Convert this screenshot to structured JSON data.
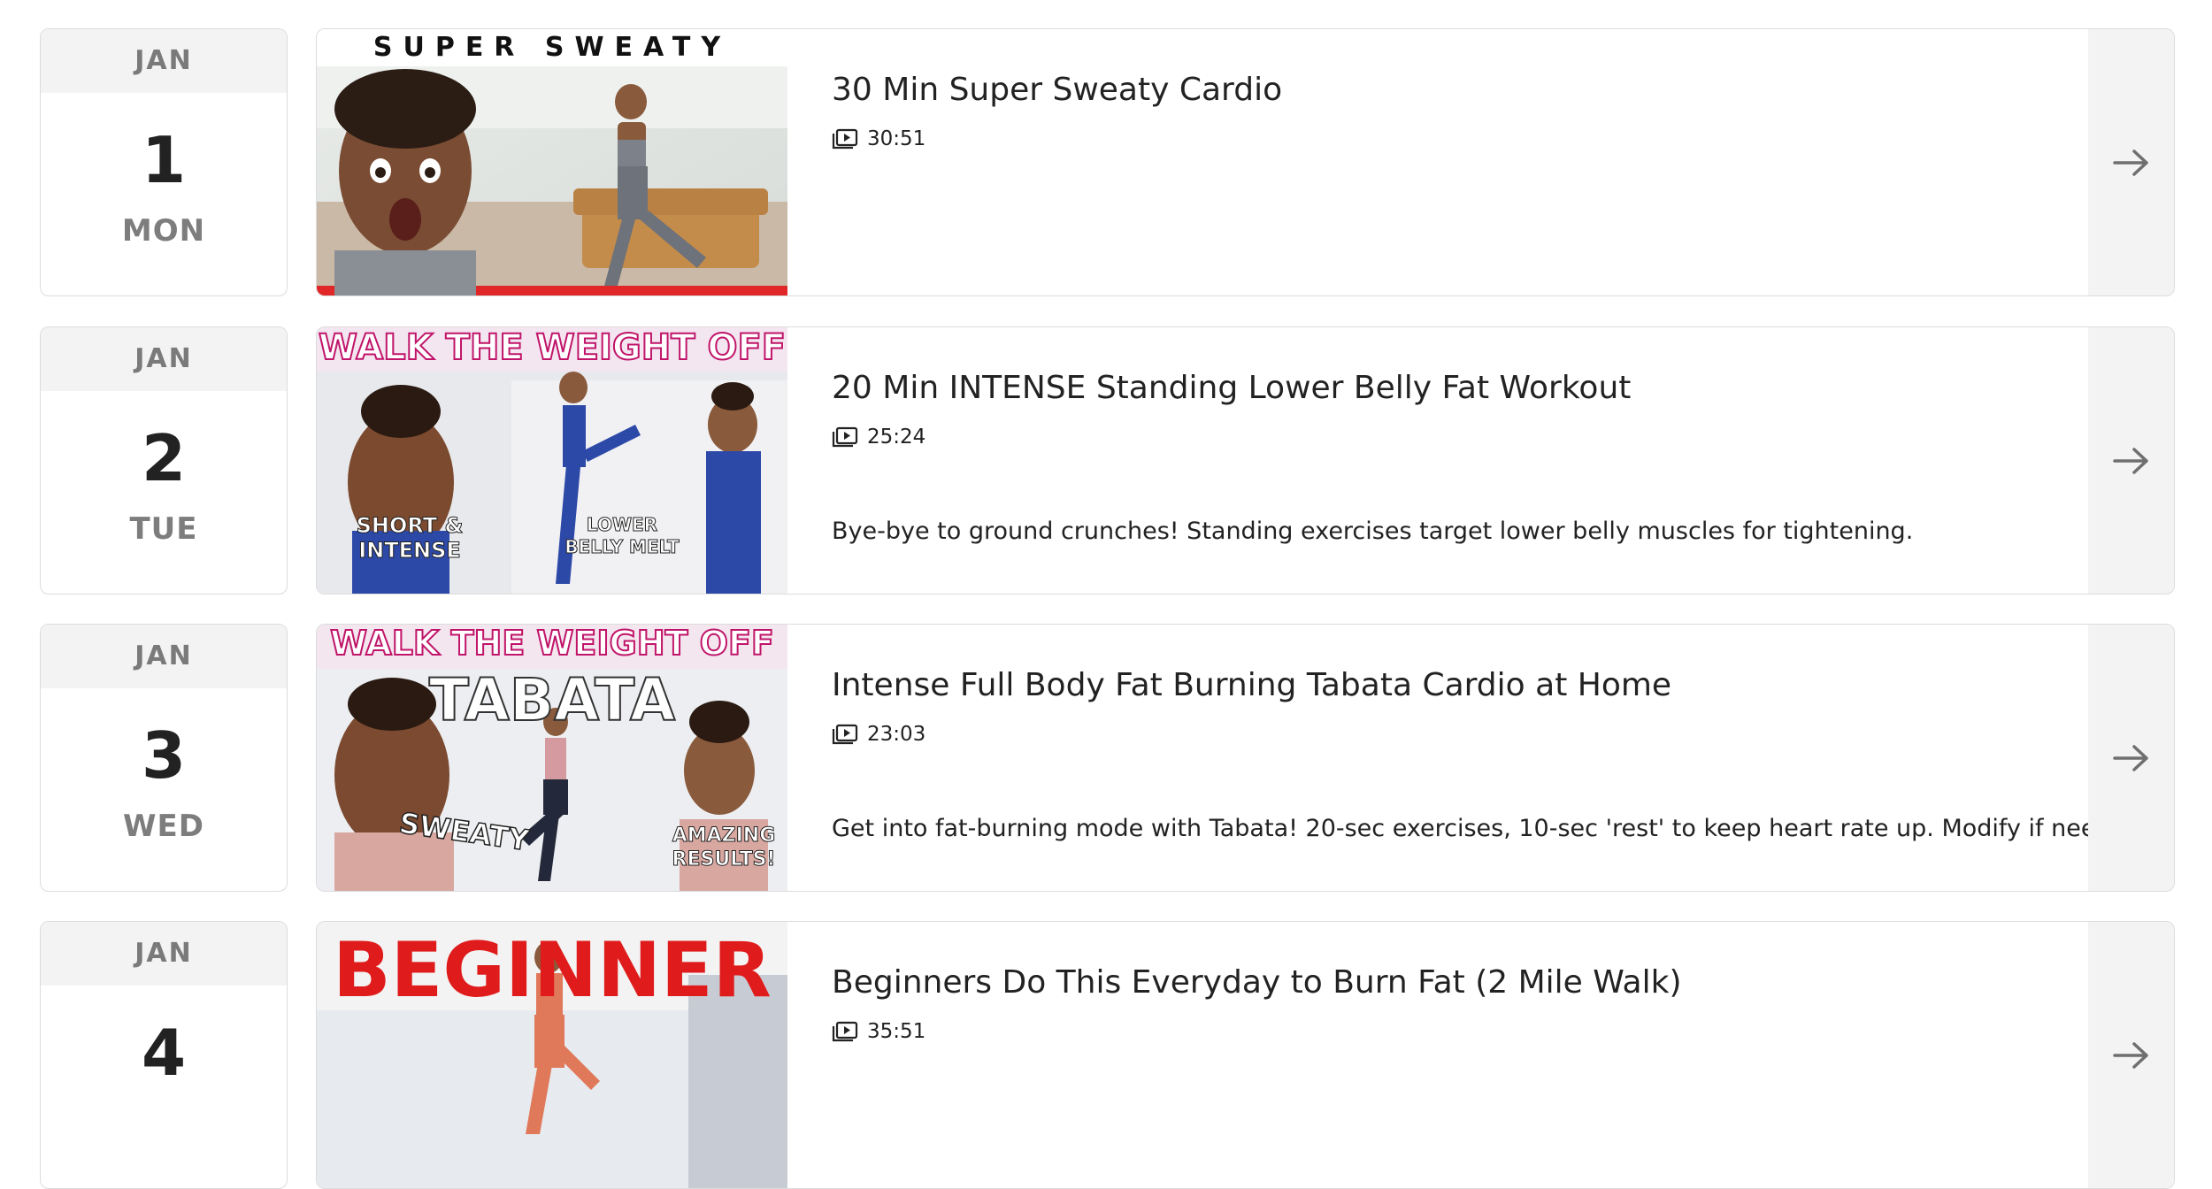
{
  "schedule": [
    {
      "month": "JAN",
      "day": "1",
      "weekday": "MON",
      "title": "30 Min Super Sweaty Cardio",
      "duration": "30:51",
      "description": "",
      "thumb_text": [
        "SUPER SWEATY"
      ]
    },
    {
      "month": "JAN",
      "day": "2",
      "weekday": "TUE",
      "title": "20 Min INTENSE Standing Lower Belly Fat Workout",
      "duration": "25:24",
      "description": "Bye-bye to ground crunches! Standing exercises target lower belly muscles for tightening.",
      "thumb_text": [
        "WALK THE WEIGHT OFF",
        "SHORT &",
        "INTENSE",
        "LOWER",
        "BELLY MELT"
      ]
    },
    {
      "month": "JAN",
      "day": "3",
      "weekday": "WED",
      "title": "Intense Full Body Fat Burning Tabata Cardio at Home",
      "duration": "23:03",
      "description": "Get into fat-burning mode with Tabata! 20-sec exercises, 10-sec 'rest' to keep heart rate up. Modify if needed.",
      "thumb_text": [
        "WALK THE WEIGHT OFF",
        "TABATA",
        "SWEATY",
        "AMAZING",
        "RESULTS!"
      ]
    },
    {
      "month": "JAN",
      "day": "4",
      "weekday": "",
      "title": "Beginners Do This Everyday to Burn Fat (2 Mile Walk)",
      "duration": "35:51",
      "description": "",
      "thumb_text": [
        "BEGINNER"
      ]
    }
  ],
  "icons": {
    "duration": "video-play-icon",
    "next": "arrow-right-icon"
  },
  "colors": {
    "card_border": "#dcdcdc",
    "date_header_bg": "#f3f3f3",
    "arrow_panel_bg": "#f3f3f3",
    "muted_text": "#7a7a7a",
    "thumb_red": "#e01b1b"
  }
}
